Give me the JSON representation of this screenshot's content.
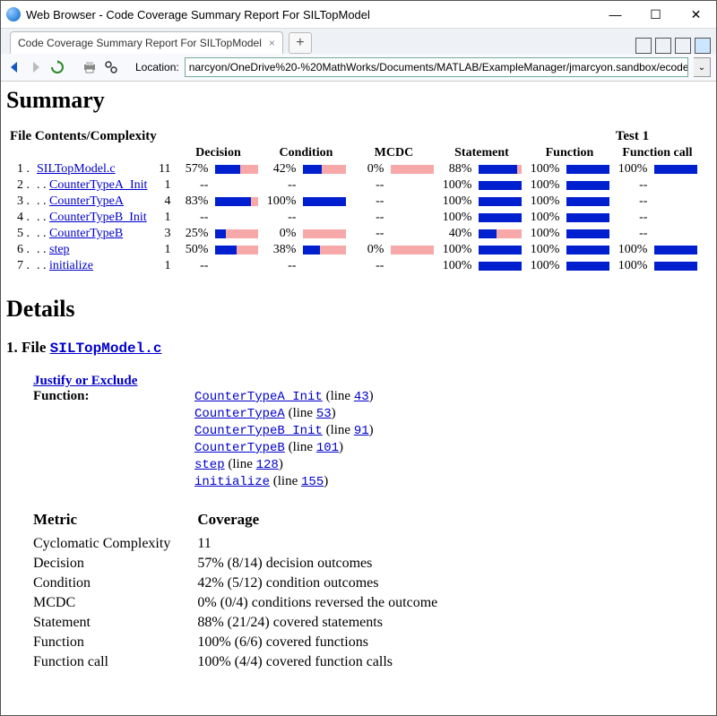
{
  "window": {
    "title": "Web Browser - Code Coverage Summary Report For SILTopModel"
  },
  "tab": {
    "label": "Code Coverage Summary Report For SILTopModel"
  },
  "toolbar": {
    "location_label": "Location:",
    "location_value": "narcyon/OneDrive%20-%20MathWorks/Documents/MATLAB/ExampleManager/jmarcyon.sandbox/ecoder-e"
  },
  "summary": {
    "heading": "Summary",
    "file_head": "File Contents/Complexity",
    "test_head": "Test 1",
    "cols": [
      "Decision",
      "Condition",
      "MCDC",
      "Statement",
      "Function",
      "Function call"
    ],
    "rows": [
      {
        "idx": "1",
        "name": "SILTopModel.c",
        "cx": "11",
        "dec": "57%",
        "decp": 57,
        "cond": "42%",
        "condp": 42,
        "mcdc": "0%",
        "mcdcp": 0,
        "stmt": "88%",
        "stmtp": 88,
        "func": "100%",
        "funcp": 100,
        "call": "100%",
        "callp": 100
      },
      {
        "idx": "2",
        "name": "CounterTypeA_Init",
        "cx": "1",
        "dec": "--",
        "decp": null,
        "cond": "--",
        "condp": null,
        "mcdc": "--",
        "mcdcp": null,
        "stmt": "100%",
        "stmtp": 100,
        "func": "100%",
        "funcp": 100,
        "call": "--",
        "callp": null
      },
      {
        "idx": "3",
        "name": "CounterTypeA",
        "cx": "4",
        "dec": "83%",
        "decp": 83,
        "cond": "100%",
        "condp": 100,
        "mcdc": "--",
        "mcdcp": null,
        "stmt": "100%",
        "stmtp": 100,
        "func": "100%",
        "funcp": 100,
        "call": "--",
        "callp": null
      },
      {
        "idx": "4",
        "name": "CounterTypeB_Init",
        "cx": "1",
        "dec": "--",
        "decp": null,
        "cond": "--",
        "condp": null,
        "mcdc": "--",
        "mcdcp": null,
        "stmt": "100%",
        "stmtp": 100,
        "func": "100%",
        "funcp": 100,
        "call": "--",
        "callp": null
      },
      {
        "idx": "5",
        "name": "CounterTypeB",
        "cx": "3",
        "dec": "25%",
        "decp": 25,
        "cond": "0%",
        "condp": 0,
        "mcdc": "--",
        "mcdcp": null,
        "stmt": "40%",
        "stmtp": 40,
        "func": "100%",
        "funcp": 100,
        "call": "--",
        "callp": null
      },
      {
        "idx": "6",
        "name": "step",
        "cx": "1",
        "dec": "50%",
        "decp": 50,
        "cond": "38%",
        "condp": 38,
        "mcdc": "0%",
        "mcdcp": 0,
        "stmt": "100%",
        "stmtp": 100,
        "func": "100%",
        "funcp": 100,
        "call": "100%",
        "callp": 100
      },
      {
        "idx": "7",
        "name": "initialize",
        "cx": "1",
        "dec": "--",
        "decp": null,
        "cond": "--",
        "condp": null,
        "mcdc": "--",
        "mcdcp": null,
        "stmt": "100%",
        "stmtp": 100,
        "func": "100%",
        "funcp": 100,
        "call": "100%",
        "callp": 100
      }
    ]
  },
  "details": {
    "heading": "Details",
    "file_label": "1. File ",
    "file_name": "SILTopModel.c",
    "justify": "Justify or Exclude",
    "function_label": "Function:",
    "functions": [
      {
        "name": "CounterTypeA_Init",
        "line": "43"
      },
      {
        "name": "CounterTypeA",
        "line": "53"
      },
      {
        "name": "CounterTypeB_Init",
        "line": "91"
      },
      {
        "name": "CounterTypeB",
        "line": "101"
      },
      {
        "name": "step",
        "line": "128"
      },
      {
        "name": "initialize",
        "line": "155"
      }
    ],
    "metric_head": "Metric",
    "coverage_head": "Coverage",
    "metrics": [
      {
        "m": "Cyclomatic Complexity",
        "c": "11"
      },
      {
        "m": "Decision",
        "c": "57% (8/14) decision outcomes"
      },
      {
        "m": "Condition",
        "c": "42% (5/12) condition outcomes"
      },
      {
        "m": "MCDC",
        "c": "0% (0/4) conditions reversed the outcome"
      },
      {
        "m": "Statement",
        "c": "88% (21/24) covered statements"
      },
      {
        "m": "Function",
        "c": "100% (6/6) covered functions"
      },
      {
        "m": "Function call",
        "c": "100% (4/4) covered function calls"
      }
    ]
  }
}
